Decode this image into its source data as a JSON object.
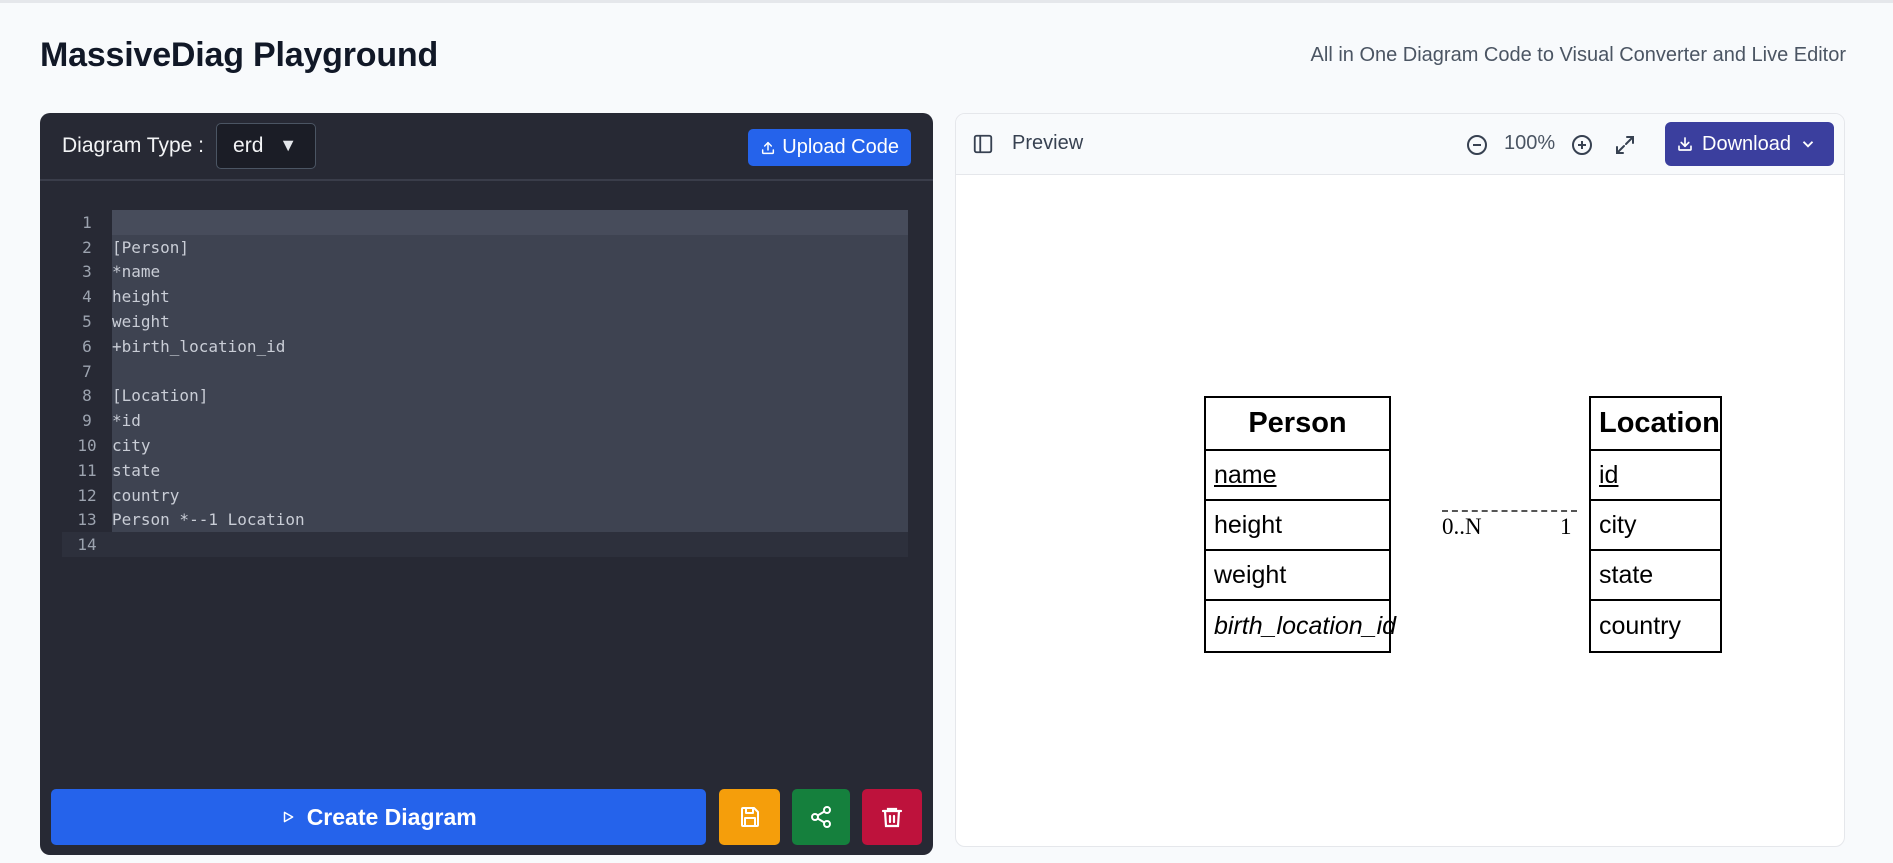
{
  "header": {
    "title": "MassiveDiag Playground",
    "subtitle": "All in One Diagram Code to Visual Converter and Live Editor"
  },
  "editor": {
    "diagram_type_label": "Diagram Type :",
    "diagram_type_value": "erd",
    "upload_label": "Upload Code",
    "lines": [
      {
        "n": "1",
        "text": ""
      },
      {
        "n": "2",
        "text": "[Person]"
      },
      {
        "n": "3",
        "text": "*name"
      },
      {
        "n": "4",
        "text": "height"
      },
      {
        "n": "5",
        "text": "weight"
      },
      {
        "n": "6",
        "text": "+birth_location_id"
      },
      {
        "n": "7",
        "text": ""
      },
      {
        "n": "8",
        "text": "[Location]"
      },
      {
        "n": "9",
        "text": "*id"
      },
      {
        "n": "10",
        "text": "city"
      },
      {
        "n": "11",
        "text": "state"
      },
      {
        "n": "12",
        "text": "country"
      },
      {
        "n": "13",
        "text": "Person *--1 Location"
      },
      {
        "n": "14",
        "text": ""
      }
    ],
    "create_label": "Create Diagram"
  },
  "preview": {
    "label": "Preview",
    "zoom": "100%",
    "download_label": "Download"
  },
  "diagram": {
    "person": {
      "title": "Person",
      "fields": [
        {
          "text": "name",
          "kind": "pk"
        },
        {
          "text": "height",
          "kind": "normal"
        },
        {
          "text": "weight",
          "kind": "normal"
        },
        {
          "text": "birth_location_id",
          "kind": "fk"
        }
      ]
    },
    "location": {
      "title": "Location",
      "fields": [
        {
          "text": "id",
          "kind": "pk"
        },
        {
          "text": "city",
          "kind": "normal"
        },
        {
          "text": "state",
          "kind": "normal"
        },
        {
          "text": "country",
          "kind": "normal"
        }
      ]
    },
    "relation": {
      "left_card": "0..N",
      "right_card": "1"
    }
  },
  "colors": {
    "editor_bg": "#272934",
    "primary": "#2563eb",
    "save": "#f59e0b",
    "share": "#15803d",
    "delete": "#be123c",
    "download": "#3b3f9e"
  }
}
